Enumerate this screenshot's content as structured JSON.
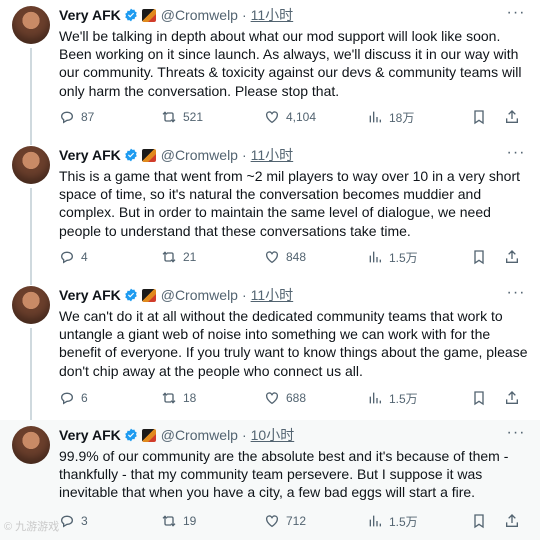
{
  "tweets": [
    {
      "name": "Very AFK",
      "handle": "@Cromwelp",
      "time": "11小时",
      "text": "We'll be talking in depth about what our mod support will look like soon. Been working on it since launch. As always, we'll discuss it in our way with our community. Threats & toxicity against our devs & community teams will only harm the conversation. Please stop that.",
      "replies": "87",
      "retweets": "521",
      "likes": "4,104",
      "views": "18万"
    },
    {
      "name": "Very AFK",
      "handle": "@Cromwelp",
      "time": "11小时",
      "text": "This is a game that went from ~2 mil players to way over 10 in a very short space of time, so it's natural the conversation becomes muddier and complex. But in order to maintain the same level of dialogue, we need people to understand that these conversations take time.",
      "replies": "4",
      "retweets": "21",
      "likes": "848",
      "views": "1.5万"
    },
    {
      "name": "Very AFK",
      "handle": "@Cromwelp",
      "time": "11小时",
      "text": "We can't do it at all without the dedicated community teams that work to untangle a giant web of noise into something we can work with for the benefit of everyone. If you truly want to know things about the game, please don't chip away at the people who connect us all.",
      "replies": "6",
      "retweets": "18",
      "likes": "688",
      "views": "1.5万"
    },
    {
      "name": "Very AFK",
      "handle": "@Cromwelp",
      "time": "10小时",
      "text": "99.9% of our community are the absolute best and it's because of them - thankfully - that my community team persevere. But I suppose it was inevitable that when you have a city, a few bad eggs will start a fire.",
      "replies": "3",
      "retweets": "19",
      "likes": "712",
      "views": "1.5万"
    }
  ],
  "watermark": "© 九游游戏",
  "colors": {
    "verified": "#1d9bf0",
    "muted": "#536471",
    "text": "#0f1419"
  }
}
